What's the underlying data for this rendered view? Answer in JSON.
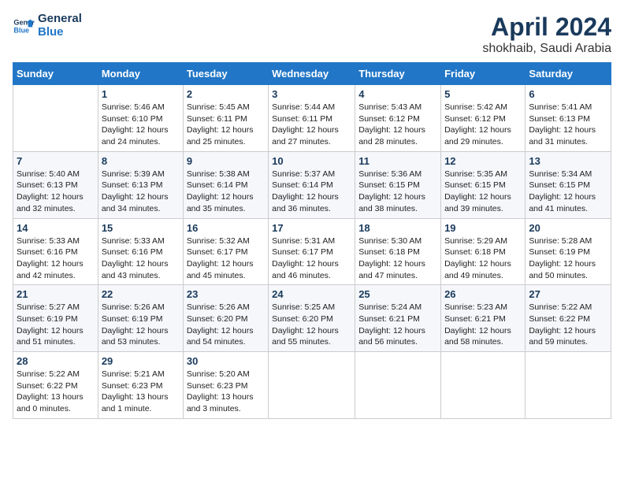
{
  "header": {
    "logo_line1": "General",
    "logo_line2": "Blue",
    "title": "April 2024",
    "subtitle": "shokhaib, Saudi Arabia"
  },
  "weekdays": [
    "Sunday",
    "Monday",
    "Tuesday",
    "Wednesday",
    "Thursday",
    "Friday",
    "Saturday"
  ],
  "weeks": [
    [
      {
        "day": "",
        "info": ""
      },
      {
        "day": "1",
        "info": "Sunrise: 5:46 AM\nSunset: 6:10 PM\nDaylight: 12 hours\nand 24 minutes."
      },
      {
        "day": "2",
        "info": "Sunrise: 5:45 AM\nSunset: 6:11 PM\nDaylight: 12 hours\nand 25 minutes."
      },
      {
        "day": "3",
        "info": "Sunrise: 5:44 AM\nSunset: 6:11 PM\nDaylight: 12 hours\nand 27 minutes."
      },
      {
        "day": "4",
        "info": "Sunrise: 5:43 AM\nSunset: 6:12 PM\nDaylight: 12 hours\nand 28 minutes."
      },
      {
        "day": "5",
        "info": "Sunrise: 5:42 AM\nSunset: 6:12 PM\nDaylight: 12 hours\nand 29 minutes."
      },
      {
        "day": "6",
        "info": "Sunrise: 5:41 AM\nSunset: 6:13 PM\nDaylight: 12 hours\nand 31 minutes."
      }
    ],
    [
      {
        "day": "7",
        "info": "Sunrise: 5:40 AM\nSunset: 6:13 PM\nDaylight: 12 hours\nand 32 minutes."
      },
      {
        "day": "8",
        "info": "Sunrise: 5:39 AM\nSunset: 6:13 PM\nDaylight: 12 hours\nand 34 minutes."
      },
      {
        "day": "9",
        "info": "Sunrise: 5:38 AM\nSunset: 6:14 PM\nDaylight: 12 hours\nand 35 minutes."
      },
      {
        "day": "10",
        "info": "Sunrise: 5:37 AM\nSunset: 6:14 PM\nDaylight: 12 hours\nand 36 minutes."
      },
      {
        "day": "11",
        "info": "Sunrise: 5:36 AM\nSunset: 6:15 PM\nDaylight: 12 hours\nand 38 minutes."
      },
      {
        "day": "12",
        "info": "Sunrise: 5:35 AM\nSunset: 6:15 PM\nDaylight: 12 hours\nand 39 minutes."
      },
      {
        "day": "13",
        "info": "Sunrise: 5:34 AM\nSunset: 6:15 PM\nDaylight: 12 hours\nand 41 minutes."
      }
    ],
    [
      {
        "day": "14",
        "info": "Sunrise: 5:33 AM\nSunset: 6:16 PM\nDaylight: 12 hours\nand 42 minutes."
      },
      {
        "day": "15",
        "info": "Sunrise: 5:33 AM\nSunset: 6:16 PM\nDaylight: 12 hours\nand 43 minutes."
      },
      {
        "day": "16",
        "info": "Sunrise: 5:32 AM\nSunset: 6:17 PM\nDaylight: 12 hours\nand 45 minutes."
      },
      {
        "day": "17",
        "info": "Sunrise: 5:31 AM\nSunset: 6:17 PM\nDaylight: 12 hours\nand 46 minutes."
      },
      {
        "day": "18",
        "info": "Sunrise: 5:30 AM\nSunset: 6:18 PM\nDaylight: 12 hours\nand 47 minutes."
      },
      {
        "day": "19",
        "info": "Sunrise: 5:29 AM\nSunset: 6:18 PM\nDaylight: 12 hours\nand 49 minutes."
      },
      {
        "day": "20",
        "info": "Sunrise: 5:28 AM\nSunset: 6:19 PM\nDaylight: 12 hours\nand 50 minutes."
      }
    ],
    [
      {
        "day": "21",
        "info": "Sunrise: 5:27 AM\nSunset: 6:19 PM\nDaylight: 12 hours\nand 51 minutes."
      },
      {
        "day": "22",
        "info": "Sunrise: 5:26 AM\nSunset: 6:19 PM\nDaylight: 12 hours\nand 53 minutes."
      },
      {
        "day": "23",
        "info": "Sunrise: 5:26 AM\nSunset: 6:20 PM\nDaylight: 12 hours\nand 54 minutes."
      },
      {
        "day": "24",
        "info": "Sunrise: 5:25 AM\nSunset: 6:20 PM\nDaylight: 12 hours\nand 55 minutes."
      },
      {
        "day": "25",
        "info": "Sunrise: 5:24 AM\nSunset: 6:21 PM\nDaylight: 12 hours\nand 56 minutes."
      },
      {
        "day": "26",
        "info": "Sunrise: 5:23 AM\nSunset: 6:21 PM\nDaylight: 12 hours\nand 58 minutes."
      },
      {
        "day": "27",
        "info": "Sunrise: 5:22 AM\nSunset: 6:22 PM\nDaylight: 12 hours\nand 59 minutes."
      }
    ],
    [
      {
        "day": "28",
        "info": "Sunrise: 5:22 AM\nSunset: 6:22 PM\nDaylight: 13 hours\nand 0 minutes."
      },
      {
        "day": "29",
        "info": "Sunrise: 5:21 AM\nSunset: 6:23 PM\nDaylight: 13 hours\nand 1 minute."
      },
      {
        "day": "30",
        "info": "Sunrise: 5:20 AM\nSunset: 6:23 PM\nDaylight: 13 hours\nand 3 minutes."
      },
      {
        "day": "",
        "info": ""
      },
      {
        "day": "",
        "info": ""
      },
      {
        "day": "",
        "info": ""
      },
      {
        "day": "",
        "info": ""
      }
    ]
  ]
}
